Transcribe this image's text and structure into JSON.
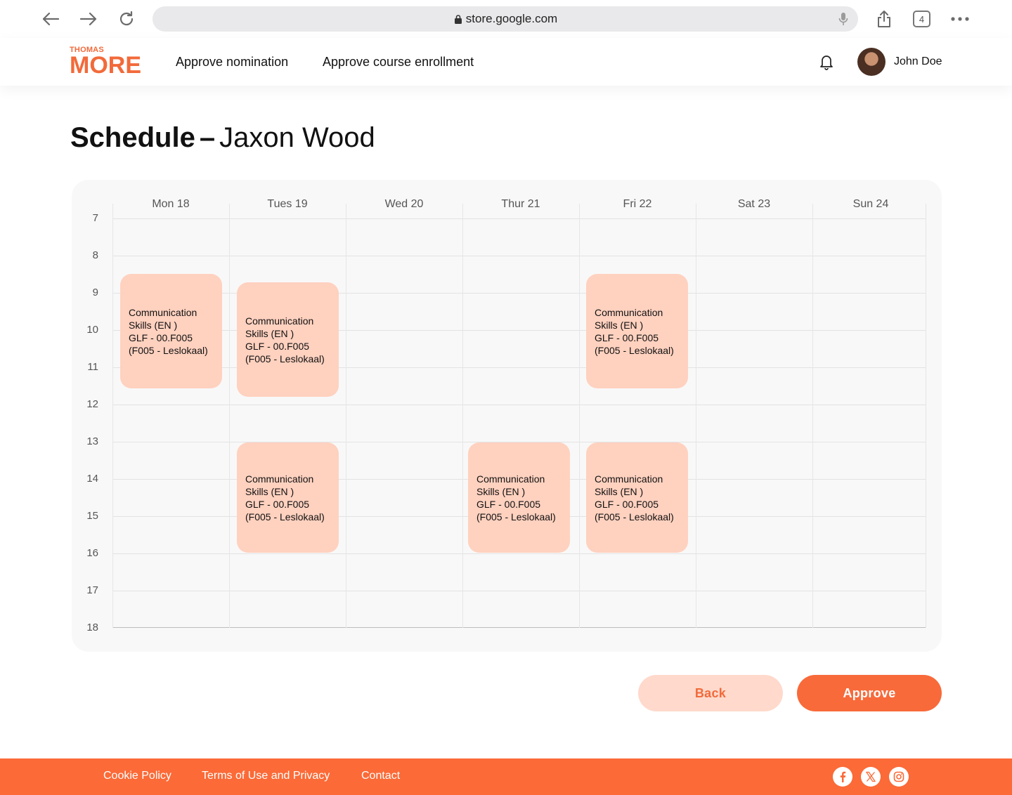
{
  "browser": {
    "url": "store.google.com",
    "tab_count": "4",
    "icons": [
      "back-arrow-icon",
      "forward-arrow-icon",
      "reload-icon",
      "lock-icon",
      "mic-icon",
      "share-icon",
      "tabs-icon",
      "more-icon"
    ]
  },
  "header": {
    "logo_top": "THOMAS",
    "logo_bottom": "MORE",
    "nav": [
      {
        "label": "Approve nomination"
      },
      {
        "label": "Approve course enrollment"
      }
    ],
    "user_name": "John Doe"
  },
  "page": {
    "title_bold": "Schedule",
    "title_sep": "–",
    "title_name": "Jaxon Wood"
  },
  "calendar": {
    "days": [
      "Mon 18",
      "Tues 19",
      "Wed 20",
      "Thur 21",
      "Fri 22",
      "Sat 23",
      "Sun 24"
    ],
    "hours": [
      "7",
      "8",
      "9",
      "10",
      "11",
      "12",
      "13",
      "14",
      "15",
      "16",
      "17",
      "18"
    ],
    "events": [
      {
        "day": "Mon 18",
        "lines": [
          "Communication",
          "Skills (EN )",
          "GLF - 00.F005",
          "(F005 - Leslokaal)"
        ]
      },
      {
        "day": "Tues 19",
        "lines": [
          "Communication",
          "Skills (EN )",
          "GLF - 00.F005",
          "(F005 - Leslokaal)"
        ]
      },
      {
        "day": "Fri 22",
        "lines": [
          "Communication",
          "Skills (EN )",
          "GLF - 00.F005",
          "(F005 - Leslokaal)"
        ]
      },
      {
        "day": "Tues 19",
        "lines": [
          "Communication",
          "Skills (EN )",
          "GLF - 00.F005",
          "(F005 - Leslokaal)"
        ]
      },
      {
        "day": "Thur 21",
        "lines": [
          "Communication",
          "Skills (EN )",
          "GLF - 00.F005",
          "(F005 - Leslokaal)"
        ]
      },
      {
        "day": "Fri 22",
        "lines": [
          "Communication",
          "Skills (EN )",
          "GLF - 00.F005",
          "(F005 - Leslokaal)"
        ]
      }
    ]
  },
  "actions": {
    "back_label": "Back",
    "approve_label": "Approve"
  },
  "footer": {
    "links": [
      "Cookie Policy",
      "Terms of Use and Privacy",
      "Contact"
    ],
    "social_icons": [
      "facebook-icon",
      "x-icon",
      "instagram-icon"
    ]
  },
  "colors": {
    "brand": "#f86a3a",
    "event_bg": "#ffd1bf",
    "back_bg": "#ffd9cc",
    "calendar_bg": "#f8f8f8"
  }
}
